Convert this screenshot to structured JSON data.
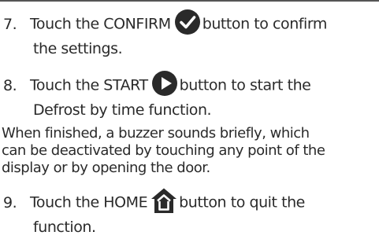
{
  "steps": [
    {
      "number": "7.",
      "text_before": "Touch the CONFIRM",
      "icon": "confirm-checkmark-icon",
      "text_after": "button to confirm",
      "continuation": "the settings."
    },
    {
      "number": "8.",
      "text_before": "Touch the START",
      "icon": "start-play-icon",
      "text_after": "button to start the",
      "continuation": "Defrost by time function."
    },
    {
      "number": "9.",
      "text_before": "Touch the HOME",
      "icon": "home-icon",
      "text_after": "button to quit the",
      "continuation": "function."
    }
  ],
  "note_lines": [
    "When finished, a buzzer sounds briefly, which",
    "can be deactivated by touching any point of the",
    "display or by opening the door."
  ],
  "colors": {
    "text": "#2a2a2a",
    "icon_fill": "#2a2a2a",
    "top_rule": "#555555"
  }
}
